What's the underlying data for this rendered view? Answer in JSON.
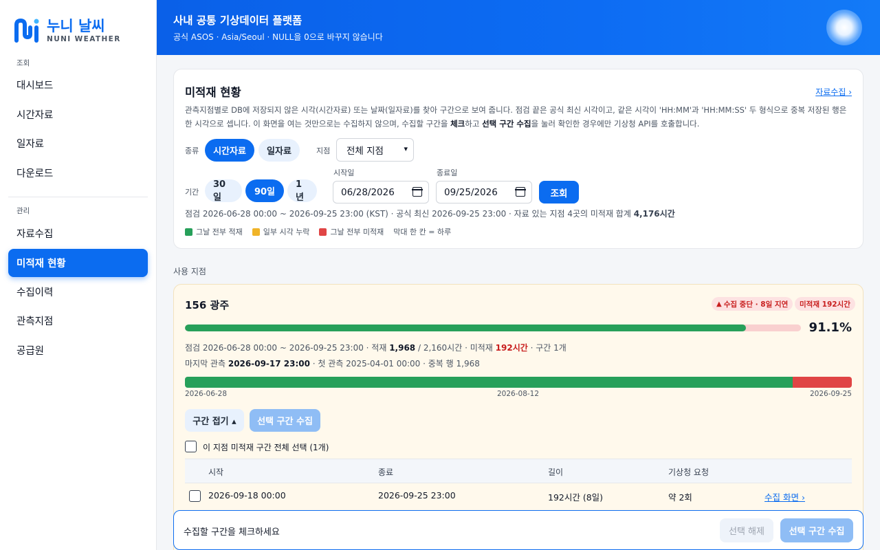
{
  "brand": {
    "title": "누니 날씨",
    "subtitle": "NUNI WEATHER",
    "color": "#0b6cf0"
  },
  "sidebar": {
    "sections": [
      {
        "label": "조회",
        "items": [
          "대시보드",
          "시간자료",
          "일자료",
          "다운로드"
        ]
      },
      {
        "label": "관리",
        "items": [
          "자료수집",
          "미적재 현황",
          "수집이력",
          "관측지점",
          "공급원"
        ]
      }
    ],
    "active": "미적재 현황"
  },
  "header": {
    "title": "사내 공통 기상데이터 플랫폼",
    "subtitle": "공식 ASOS · Asia/Seoul · NULL을 0으로 바꾸지 않습니다"
  },
  "status": {
    "title": "미적재 현황",
    "link": "자료수집 ›",
    "desc_1": "관측지점별로 DB에 저장되지 않은 시각(시간자료) 또는 날짜(일자료)를 찾아 구간으로 보여 줍니다. 점검 끝은 공식 최신 시각이고, 같은 시각이 'HH:MM'과 'HH:MM:SS' 두 형식으로 중복 저장된 행은 한 시각으로 셉니다. 이 화면을 여는 것만으로는 수집하지 않으며, 수집할 구간을 ",
    "desc_b1": "체크",
    "desc_2": "하고 ",
    "desc_b2": "선택 구간 수집",
    "desc_3": "을 눌러 확인한 경우에만 기상청 API를 호출합니다.",
    "kind_label": "종류",
    "kinds": [
      "시간자료",
      "일자료"
    ],
    "station_label": "지점",
    "station_value": "전체 지점",
    "period_label": "기간",
    "periods": [
      "30일",
      "90일",
      "1년"
    ],
    "start_label": "시작일",
    "start_value": "06/28/2026",
    "end_label": "종료일",
    "end_value": "09/25/2026",
    "query_button": "조회",
    "summary_text": "점검 2026-06-28 00:00 ~ 2026-09-25 23:00 (KST) · 공식 최신 2026-09-25 23:00 · 자료 있는 지점 4곳의 미적재 합계 ",
    "summary_total": "4,176시간",
    "legend": [
      {
        "label": "그날 전부 적재",
        "color": "#27a05a"
      },
      {
        "label": "일부 시각 누락",
        "color": "#f0b429"
      },
      {
        "label": "그날 전부 미적재",
        "color": "#e04545"
      }
    ],
    "legend_note": "막대 한 칸 = 하루"
  },
  "stations_section_label": "사용 지점",
  "station": {
    "title": "156 광주",
    "badge_stop": "수집 중단 · 8일 지연",
    "badge_missing": "미적재 192시간",
    "percent_text": "91.1%",
    "percent_value": 91.1,
    "line1_a": "점검 2026-06-28 00:00 ~ 2026-09-25 23:00 · 적재 ",
    "line1_loaded": "1,968",
    "line1_b": " / 2,160시간 · 미적재 ",
    "line1_missing": "192시간",
    "line1_c": " · 구간 1개",
    "line2_a": "마지막 관측 ",
    "line2_last": "2026-09-17 23:00",
    "line2_b": " · 첫 관측 2025-04-01 00:00 · 중복 행 1,968",
    "timeline_loaded_days": 82,
    "timeline_total_days": 90,
    "ticks": [
      "2026-06-28",
      "2026-08-12",
      "2026-09-25"
    ],
    "fold_button": "구간 접기 ▴",
    "collect_button": "선택 구간 수집",
    "select_all_label": "이 지점 미적재 구간 전체 선택 (1개)",
    "columns": [
      "시작",
      "종료",
      "길이",
      "기상청 요청"
    ],
    "rows": [
      {
        "start": "2026-09-18 00:00",
        "end": "2026-09-25 23:00",
        "length": "192시간 (8일)",
        "requests": "약 2회",
        "action": "수집 화면 ›"
      }
    ]
  },
  "bottom": {
    "hint": "수집할 구간을 체크하세요",
    "clear": "선택 해제",
    "collect": "선택 구간 수집"
  }
}
